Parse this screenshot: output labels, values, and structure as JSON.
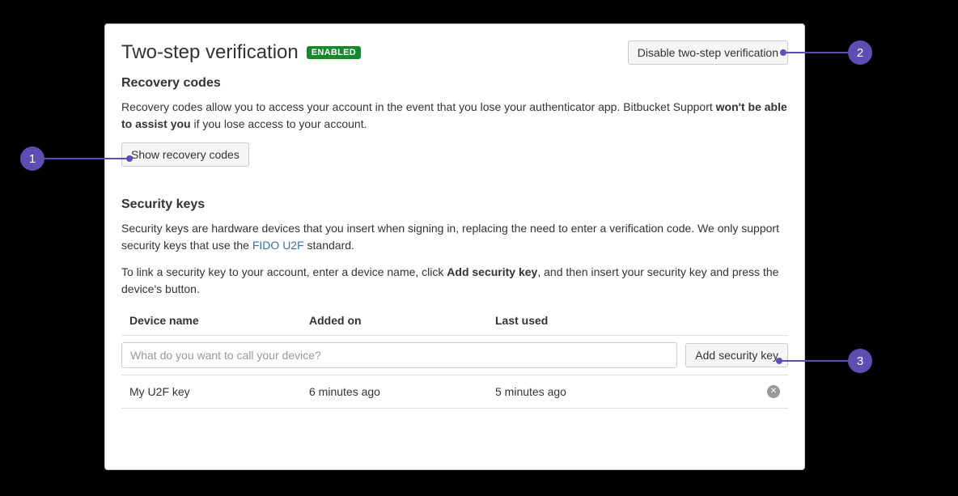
{
  "header": {
    "title": "Two-step verification",
    "badge": "ENABLED",
    "disable_button": "Disable two-step verification"
  },
  "recovery": {
    "heading": "Recovery codes",
    "desc_pre": "Recovery codes allow you to access your account in the event that you lose your authenticator app. Bitbucket Support ",
    "desc_bold": "won't be able to assist you",
    "desc_post": " if you lose access to your account.",
    "show_button": "Show recovery codes"
  },
  "security": {
    "heading": "Security keys",
    "p1_pre": "Security keys are hardware devices that you insert when signing in, replacing the need to enter a verification code. We only support security keys that use the ",
    "p1_link": "FIDO U2F",
    "p1_post": " standard.",
    "p2_pre": "To link a security key to your account, enter a device name, click ",
    "p2_bold": "Add security key",
    "p2_post": ", and then insert your security key and press the device's button.",
    "columns": {
      "name": "Device name",
      "added": "Added on",
      "last": "Last used"
    },
    "input_placeholder": "What do you want to call your device?",
    "add_button": "Add security key",
    "rows": [
      {
        "name": "My U2F key",
        "added": "6 minutes ago",
        "last": "5 minutes ago"
      }
    ]
  },
  "callouts": {
    "c1": "1",
    "c2": "2",
    "c3": "3"
  }
}
